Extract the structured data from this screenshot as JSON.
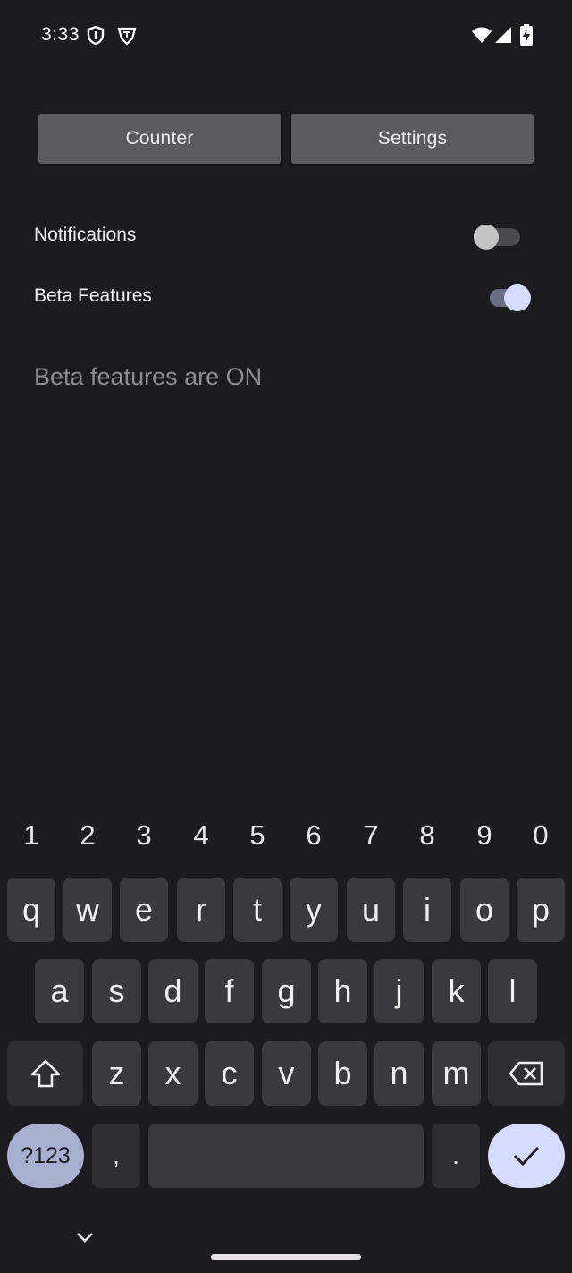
{
  "status_bar": {
    "time": "3:33",
    "icons": [
      "shield-icon",
      "vpn-badge-icon",
      "wifi-icon",
      "signal-icon",
      "battery-charging-icon"
    ]
  },
  "tabs": {
    "counter_label": "Counter",
    "settings_label": "Settings"
  },
  "settings": {
    "notifications": {
      "label": "Notifications",
      "on": false
    },
    "beta_features": {
      "label": "Beta Features",
      "on": true
    }
  },
  "message": "Beta features are ON",
  "keyboard": {
    "numbers": [
      "1",
      "2",
      "3",
      "4",
      "5",
      "6",
      "7",
      "8",
      "9",
      "0"
    ],
    "row1": [
      "q",
      "w",
      "e",
      "r",
      "t",
      "y",
      "u",
      "i",
      "o",
      "p"
    ],
    "row2": [
      "a",
      "s",
      "d",
      "f",
      "g",
      "h",
      "j",
      "k",
      "l"
    ],
    "row3": [
      "z",
      "x",
      "c",
      "v",
      "b",
      "n",
      "m"
    ],
    "symbols_label": "?123",
    "comma": ",",
    "period": ".",
    "icons": [
      "shift-icon",
      "backspace-icon",
      "enter-check-icon",
      "hide-keyboard-chevron-icon"
    ]
  },
  "colors": {
    "background": "#1c1b1f",
    "button": "#5b5b5e",
    "switch_on_thumb": "#d6dcff",
    "switch_off_thumb": "#c4c4c4"
  }
}
